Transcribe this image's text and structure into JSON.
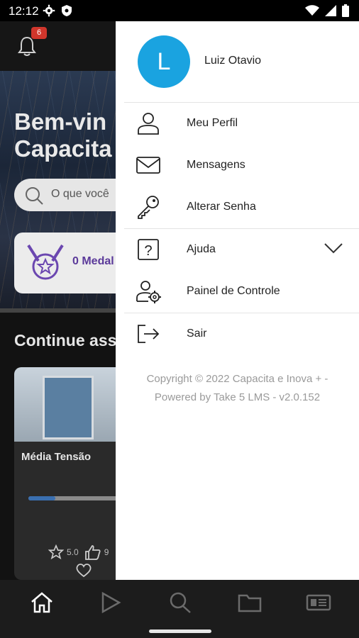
{
  "status_bar": {
    "time": "12:12"
  },
  "background_app": {
    "notification_count": "6",
    "welcome_line1": "Bem-vin",
    "welcome_line2": "Capacita",
    "search_placeholder": "O que você",
    "medals_text": "0 Medal",
    "continue_heading": "Continue ass",
    "course": {
      "title": "Média Tensão",
      "rating": "5.0",
      "likes": "9",
      "progress": 0.16
    }
  },
  "drawer": {
    "avatar_initial": "L",
    "user_name": "Luiz Otavio",
    "items": [
      {
        "label": "Meu Perfil",
        "icon": "user-icon"
      },
      {
        "label": "Mensagens",
        "icon": "envelope-icon"
      },
      {
        "label": "Alterar Senha",
        "icon": "key-icon"
      },
      {
        "label": "Ajuda",
        "icon": "help-icon"
      },
      {
        "label": "Painel de Controle",
        "icon": "user-settings-icon"
      },
      {
        "label": "Sair",
        "icon": "logout-icon"
      }
    ],
    "copyright_line1": "Copyright © 2022 Capacita e Inova + -",
    "copyright_line2": "Powered by Take 5 LMS - v2.0.152"
  },
  "bottom_nav": {
    "items": [
      "home-icon",
      "play-icon",
      "search-icon",
      "folder-icon",
      "news-icon"
    ],
    "active": "home-icon"
  },
  "colors": {
    "avatar": "#1aa3e0",
    "badge": "#d0362c",
    "medal_text": "#5b3a9a"
  }
}
